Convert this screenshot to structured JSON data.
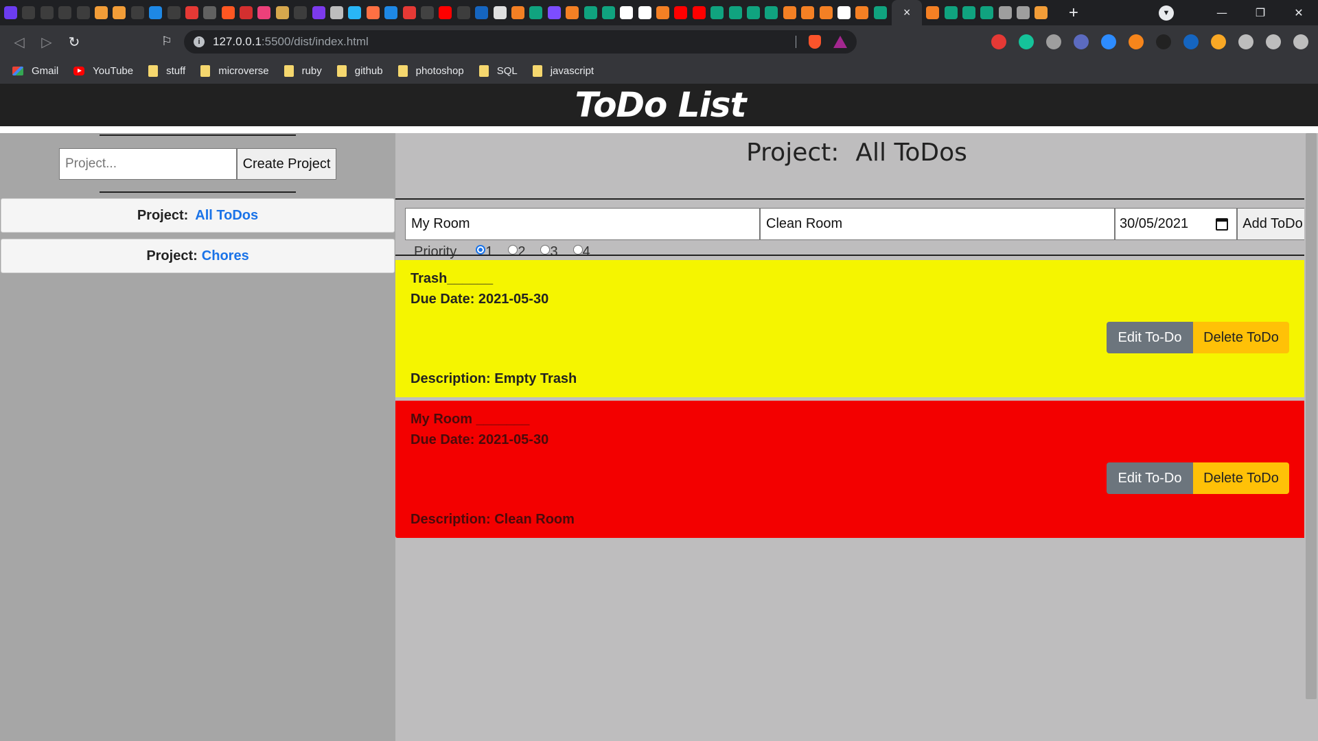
{
  "browser": {
    "tab_favicon_colors": [
      "#6b3cf0",
      "#3d3d3d",
      "#3d3d3d",
      "#3d3d3d",
      "#3d3d3d",
      "#f29d38",
      "#f29d38",
      "#3d3d3d",
      "#1e88e5",
      "#3d3d3d",
      "#e53935",
      "#616161",
      "#ff5722",
      "#d32f2f",
      "#ec407a",
      "#d7a84d",
      "#3d3d3d",
      "#7c3aed",
      "#bdbdbd",
      "#29b6f6",
      "#ff7043",
      "#1e88e5",
      "#e53935",
      "#424242",
      "#ff0000",
      "#3d3d3d",
      "#1565c0",
      "#e0e0e0",
      "#f48024",
      "#10a37f",
      "#7c4dff",
      "#f48024",
      "#10a37f",
      "#10a37f",
      "#ffffff",
      "#ffffff",
      "#f48024",
      "#ff0000",
      "#ff0000",
      "#10a37f",
      "#10a37f",
      "#10a37f",
      "#10a37f",
      "#f48024",
      "#f48024",
      "#f48024",
      "#ffffff",
      "#f48024",
      "#10a37f"
    ],
    "after_active_favicon_colors": [
      "#f48024",
      "#10a37f",
      "#10a37f",
      "#10a37f",
      "#9e9e9e",
      "#9e9e9e",
      "#f29d38"
    ],
    "active_tab_close": "×",
    "new_tab": "+",
    "url_host": "127.0.0.1",
    "url_path": ":5500/dist/index.html",
    "window_minimize": "—",
    "window_restore": "❐",
    "window_close": "✕",
    "ext_colors": [
      "#e53935",
      "#15c39a",
      "#9e9e9e",
      "#5c6bc0",
      "#2d8cff",
      "#f6851b",
      "#222222",
      "#1565c0",
      "#f9a825",
      "#bdbdbd",
      "#bdbdbd",
      "#bdbdbd"
    ],
    "bookmarks": [
      {
        "label": "Gmail",
        "icon": "gmail"
      },
      {
        "label": "YouTube",
        "icon": "yt"
      },
      {
        "label": "stuff",
        "icon": "folder"
      },
      {
        "label": "microverse",
        "icon": "folder"
      },
      {
        "label": "ruby",
        "icon": "folder"
      },
      {
        "label": "github",
        "icon": "folder"
      },
      {
        "label": "photoshop",
        "icon": "folder"
      },
      {
        "label": "SQL",
        "icon": "folder"
      },
      {
        "label": "javascript",
        "icon": "folder"
      }
    ]
  },
  "app": {
    "title": "ToDo List",
    "sidebar": {
      "project_placeholder": "Project...",
      "create_button": "Create Project",
      "projects": [
        {
          "prefix": "Project:",
          "name": "All ToDos"
        },
        {
          "prefix": "Project:",
          "name": "Chores"
        }
      ]
    },
    "main": {
      "title_label": "Project:",
      "title_name": "All ToDos",
      "form": {
        "title_value": "My Room",
        "description_value": "Clean Room",
        "date_value": "30/05/2021",
        "add_button": "Add ToDo",
        "priority_label": "Priority",
        "priorities": [
          "1",
          "2",
          "3",
          "4"
        ],
        "selected_priority": "1"
      },
      "todos": [
        {
          "title": "Trash______",
          "due": "Due Date: 2021-05-30",
          "description": "Description: Empty Trash",
          "color": "#f5f500",
          "edit": "Edit To-Do",
          "delete": "Delete ToDo"
        },
        {
          "title": "My Room _______",
          "due": "Due Date: 2021-05-30",
          "description": "Description: Clean Room",
          "color": "#f30000",
          "edit": "Edit To-Do",
          "delete": "Delete ToDo"
        }
      ]
    }
  }
}
